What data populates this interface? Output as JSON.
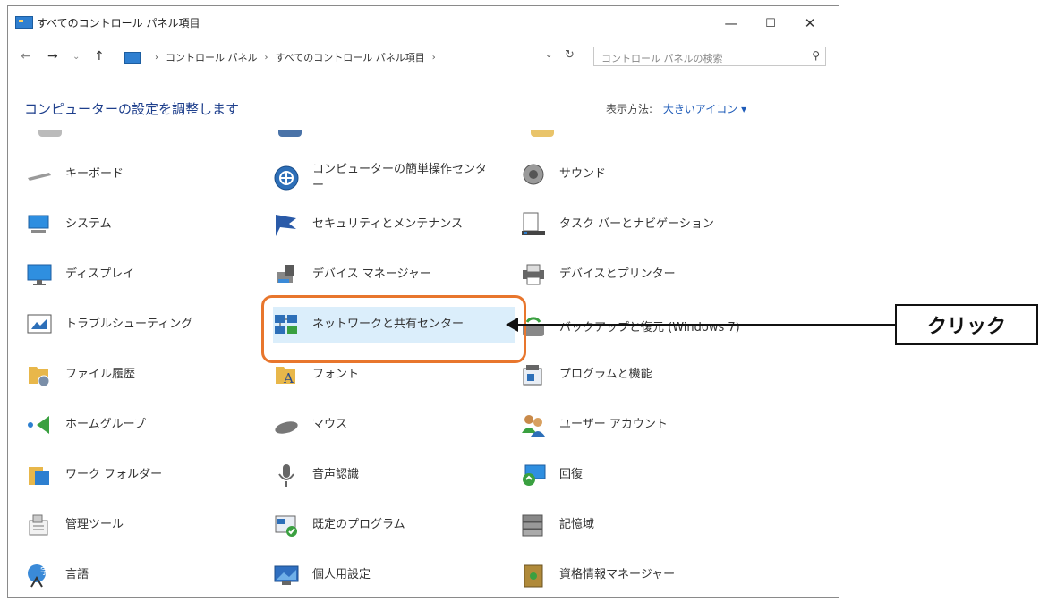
{
  "window": {
    "title": "すべてのコントロール パネル項目",
    "controls": {
      "minimize": "—",
      "maximize": "☐",
      "close": "✕"
    }
  },
  "address_bar": {
    "crumbs": [
      "コントロール パネル",
      "すべてのコントロール パネル項目"
    ],
    "search_placeholder": "コントロール パネルの検索"
  },
  "header": {
    "heading": "コンピューターの設定を調整します",
    "view_by_label": "表示方法:",
    "view_by_value": "大きいアイコン ▾"
  },
  "items": [
    [
      {
        "label": "キーボード",
        "icon": "keyboard-icon"
      },
      {
        "label": "システム",
        "icon": "system-icon"
      },
      {
        "label": "ディスプレイ",
        "icon": "display-icon"
      },
      {
        "label": "トラブルシューティング",
        "icon": "troubleshooting-icon"
      },
      {
        "label": "ファイル履歴",
        "icon": "file-history-icon"
      },
      {
        "label": "ホームグループ",
        "icon": "homegroup-icon"
      },
      {
        "label": "ワーク フォルダー",
        "icon": "work-folders-icon"
      },
      {
        "label": "管理ツール",
        "icon": "admin-tools-icon"
      },
      {
        "label": "言語",
        "icon": "language-icon"
      }
    ],
    [
      {
        "label": "コンピューターの簡単操作センター",
        "icon": "ease-of-access-icon"
      },
      {
        "label": "セキュリティとメンテナンス",
        "icon": "security-flag-icon"
      },
      {
        "label": "デバイス マネージャー",
        "icon": "device-manager-icon"
      },
      {
        "label": "ネットワークと共有センター",
        "icon": "network-icon"
      },
      {
        "label": "フォント",
        "icon": "fonts-icon"
      },
      {
        "label": "マウス",
        "icon": "mouse-icon"
      },
      {
        "label": "音声認識",
        "icon": "microphone-icon"
      },
      {
        "label": "既定のプログラム",
        "icon": "default-programs-icon"
      },
      {
        "label": "個人用設定",
        "icon": "personalization-icon"
      }
    ],
    [
      {
        "label": "サウンド",
        "icon": "speaker-icon"
      },
      {
        "label": "タスク バーとナビゲーション",
        "icon": "taskbar-icon"
      },
      {
        "label": "デバイスとプリンター",
        "icon": "printer-icon"
      },
      {
        "label": "バックアップと復元 (Windows 7)",
        "icon": "backup-icon"
      },
      {
        "label": "プログラムと機能",
        "icon": "programs-icon"
      },
      {
        "label": "ユーザー アカウント",
        "icon": "user-accounts-icon"
      },
      {
        "label": "回復",
        "icon": "recovery-icon"
      },
      {
        "label": "記憶域",
        "icon": "storage-icon"
      },
      {
        "label": "資格情報マネージャー",
        "icon": "credential-manager-icon"
      }
    ]
  ],
  "callout": {
    "text": "クリック"
  },
  "colors": {
    "highlight": "#dbeefb",
    "frame": "#e8762d",
    "link": "#1e5bb8",
    "heading": "#1e3f8c"
  }
}
